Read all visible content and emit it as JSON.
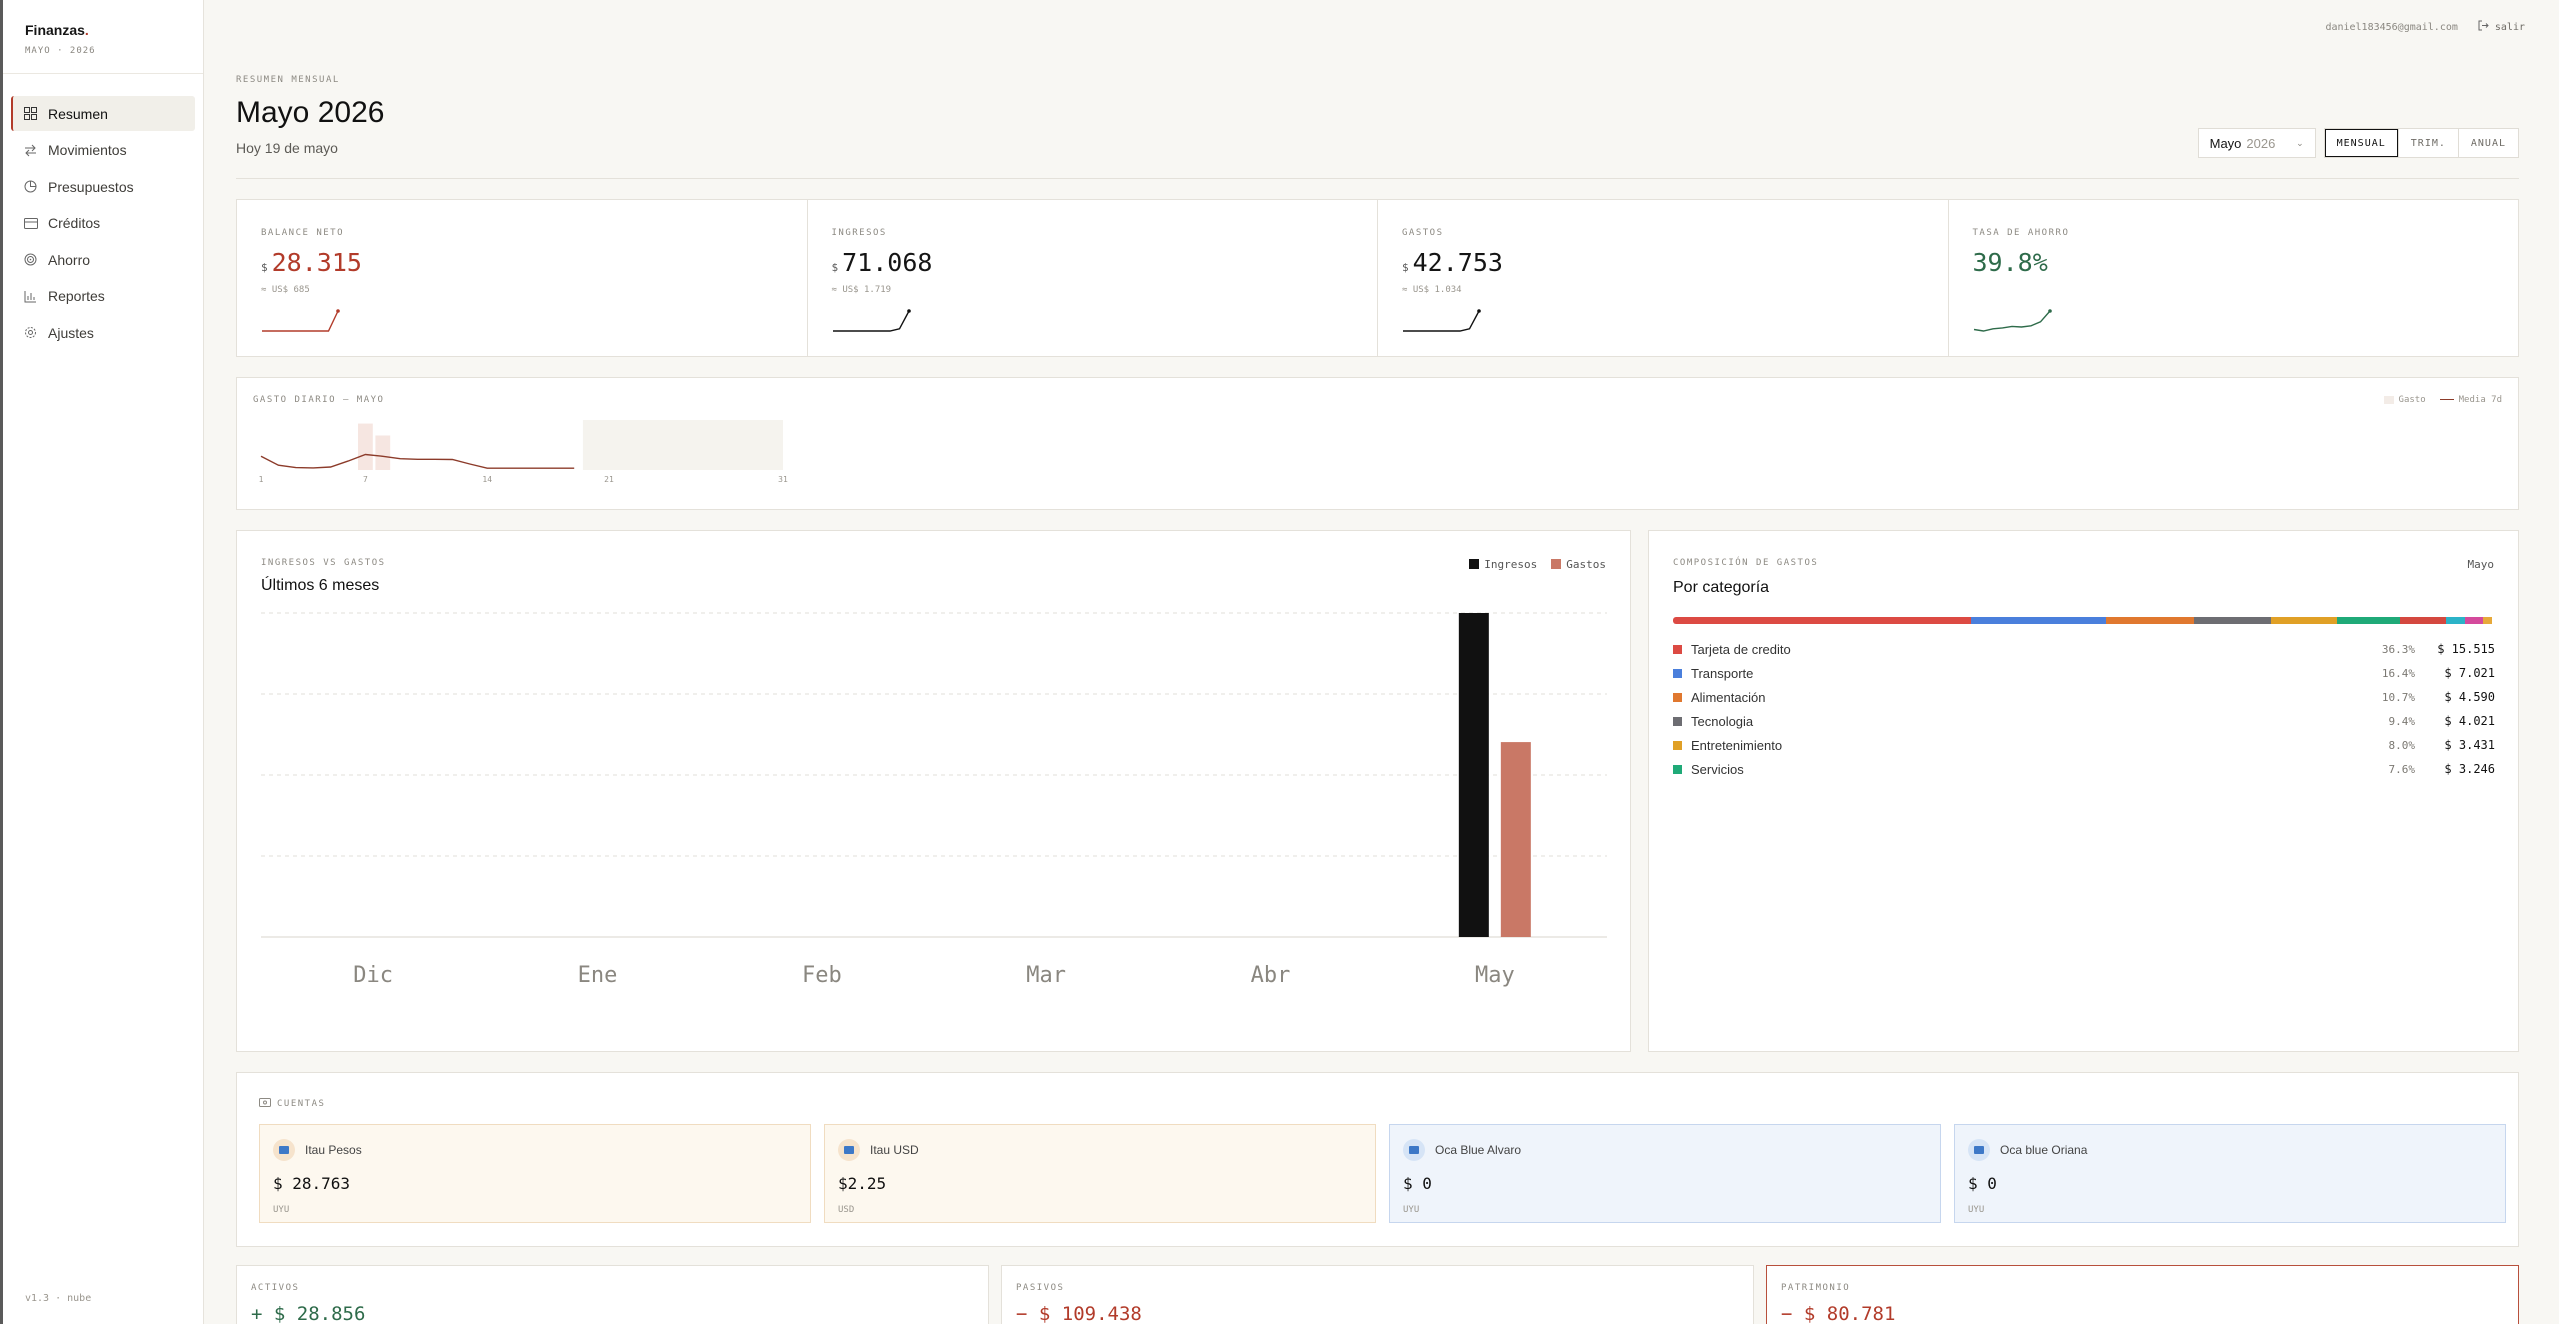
{
  "sidebar": {
    "brand": "Finanzas",
    "brand_dot": ".",
    "period": "MAYO · 2026",
    "items": [
      {
        "label": "Resumen",
        "icon": "grid-icon"
      },
      {
        "label": "Movimientos",
        "icon": "arrows-swap-icon"
      },
      {
        "label": "Presupuestos",
        "icon": "pie-chart-icon"
      },
      {
        "label": "Créditos",
        "icon": "credit-card-icon"
      },
      {
        "label": "Ahorro",
        "icon": "target-icon"
      },
      {
        "label": "Reportes",
        "icon": "bar-chart-icon"
      },
      {
        "label": "Ajustes",
        "icon": "gear-icon"
      }
    ],
    "footer": "v1.3 · nube"
  },
  "topbar": {
    "email": "daniel183456@gmail.com",
    "logout": "salir"
  },
  "header": {
    "eyebrow": "RESUMEN MENSUAL",
    "title": "Mayo 2026",
    "subtitle": "Hoy 19 de mayo",
    "month_select": {
      "month": "Mayo",
      "year": "2026"
    },
    "view_toggle": [
      "MENSUAL",
      "TRIM.",
      "ANUAL"
    ]
  },
  "kpis": [
    {
      "label": "BALANCE NETO",
      "currency": "$",
      "value": "28.315",
      "usd": "≈ US$ 685",
      "color": "#b23b2a"
    },
    {
      "label": "INGRESOS",
      "currency": "$",
      "value": "71.068",
      "usd": "≈ US$ 1.719",
      "color": "#111111"
    },
    {
      "label": "GASTOS",
      "currency": "$",
      "value": "42.753",
      "usd": "≈ US$ 1.034",
      "color": "#111111"
    },
    {
      "label": "TASA DE AHORRO",
      "currency": "",
      "value": "39.8%",
      "usd": "",
      "color": "#2e6b4a"
    }
  ],
  "daily": {
    "label": "GASTO DIARIO — MAYO",
    "legend_bar": "Gasto",
    "legend_line": "Media 7d",
    "ticks": [
      "1",
      "7",
      "14",
      "21",
      "31"
    ]
  },
  "income_vs_expenses": {
    "label": "INGRESOS VS GASTOS",
    "title": "Últimos 6 meses",
    "legend": {
      "income": "Ingresos",
      "expenses": "Gastos"
    },
    "colors": {
      "income": "#111111",
      "expenses": "#c97866"
    }
  },
  "composition": {
    "label": "COMPOSICIÓN DE GASTOS",
    "title": "Por categoría",
    "month": "Mayo",
    "bar_segments": [
      {
        "pct": 36.3,
        "color": "#dc4a43"
      },
      {
        "pct": 16.4,
        "color": "#4a7fdc"
      },
      {
        "pct": 10.7,
        "color": "#e0782f"
      },
      {
        "pct": 9.4,
        "color": "#6d6d72"
      },
      {
        "pct": 8.0,
        "color": "#e0a026"
      },
      {
        "pct": 7.6,
        "color": "#1faa78"
      },
      {
        "pct": 5.6,
        "color": "#d4483f"
      },
      {
        "pct": 2.4,
        "color": "#2bb3c8"
      },
      {
        "pct": 2.2,
        "color": "#d44a9c"
      },
      {
        "pct": 1.0,
        "color": "#e7a93a"
      }
    ],
    "categories": [
      {
        "name": "Tarjeta de credito",
        "pct": "36.3%",
        "amount": "$ 15.515",
        "color": "#dc4a43"
      },
      {
        "name": "Transporte",
        "pct": "16.4%",
        "amount": "$ 7.021",
        "color": "#4a7fdc"
      },
      {
        "name": "Alimentación",
        "pct": "10.7%",
        "amount": "$ 4.590",
        "color": "#e0782f"
      },
      {
        "name": "Tecnologia",
        "pct": "9.4%",
        "amount": "$ 4.021",
        "color": "#6d6d72"
      },
      {
        "name": "Entretenimiento",
        "pct": "8.0%",
        "amount": "$ 3.431",
        "color": "#e0a026"
      },
      {
        "name": "Servicios",
        "pct": "7.6%",
        "amount": "$ 3.246",
        "color": "#1faa78"
      }
    ]
  },
  "accounts": {
    "label": "CUENTAS",
    "items": [
      {
        "name": "Itau Pesos",
        "balance": "$ 28.763",
        "currency": "UYU",
        "tone": "warm"
      },
      {
        "name": "Itau USD",
        "balance": "$2.25",
        "currency": "USD",
        "tone": "warm"
      },
      {
        "name": "Oca Blue Alvaro",
        "balance": "$ 0",
        "currency": "UYU",
        "tone": "cool"
      },
      {
        "name": "Oca blue Oriana",
        "balance": "$ 0",
        "currency": "UYU",
        "tone": "cool"
      }
    ]
  },
  "summary": [
    {
      "label": "ACTIVOS",
      "value": "+ $ 28.856",
      "color": "#2e6b4a"
    },
    {
      "label": "PASIVOS",
      "value": "− $ 109.438",
      "color": "#b23b2a"
    },
    {
      "label": "PATRIMONIO",
      "value": "− $ 80.781",
      "color": "#b23b2a"
    }
  ],
  "chart_data": [
    {
      "type": "bar",
      "title": "Últimos 6 meses",
      "categories": [
        "Dic",
        "Ene",
        "Feb",
        "Mar",
        "Abr",
        "May"
      ],
      "series": [
        {
          "name": "Ingresos",
          "values": [
            0,
            0,
            0,
            0,
            0,
            71068
          ]
        },
        {
          "name": "Gastos",
          "values": [
            0,
            0,
            0,
            0,
            0,
            42753
          ]
        }
      ],
      "ylim": [
        0,
        71068
      ],
      "grid": true,
      "legend": "top-right"
    },
    {
      "type": "bar",
      "title": "GASTO DIARIO — MAYO",
      "x": [
        1,
        2,
        3,
        4,
        5,
        6,
        7,
        8,
        9,
        10,
        11,
        12,
        13,
        14,
        15,
        16,
        17,
        18,
        19
      ],
      "series": [
        {
          "name": "Gasto",
          "values": [
            0,
            0,
            0,
            0,
            0,
            0,
            3900,
            2900,
            0,
            0,
            0,
            0,
            0,
            0,
            0,
            0,
            0,
            0,
            0
          ]
        },
        {
          "name": "Media 7d",
          "values": [
            1150,
            400,
            200,
            180,
            250,
            750,
            1300,
            1150,
            950,
            900,
            900,
            880,
            500,
            150,
            150,
            150,
            150,
            150,
            150
          ]
        }
      ],
      "xlim": [
        1,
        31
      ],
      "legend": "top-right"
    },
    {
      "type": "line",
      "title": "BALANCE NETO",
      "values": [
        1,
        1,
        1,
        1,
        1,
        1,
        1,
        1,
        10
      ]
    },
    {
      "type": "line",
      "title": "INGRESOS",
      "values": [
        1,
        1,
        1,
        1,
        1,
        1,
        1,
        2,
        10
      ]
    },
    {
      "type": "line",
      "title": "GASTOS",
      "values": [
        1,
        1,
        1,
        1,
        1,
        1,
        1,
        2,
        10
      ]
    },
    {
      "type": "line",
      "title": "TASA DE AHORRO",
      "values": [
        3,
        2.5,
        3.2,
        3.5,
        4,
        3.8,
        4.2,
        5.5,
        9
      ]
    }
  ]
}
